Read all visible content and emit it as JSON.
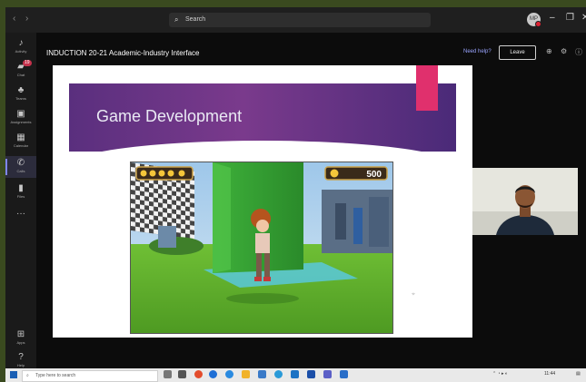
{
  "titlebar": {
    "back": "‹",
    "forward": "›",
    "search_placeholder": "Search",
    "user_initials": "MP",
    "minimize": "–",
    "maximize": "❐",
    "close": "✕"
  },
  "rail": [
    {
      "icon": "bell-icon",
      "glyph": "🔔",
      "label": "Activity",
      "active": false
    },
    {
      "icon": "chat-icon",
      "glyph": "💬",
      "label": "Chat",
      "badge": "19",
      "active": false
    },
    {
      "icon": "teams-icon",
      "glyph": "👥",
      "label": "Teams",
      "active": false
    },
    {
      "icon": "assignments-icon",
      "glyph": "🎒",
      "label": "Assignments",
      "active": false
    },
    {
      "icon": "calendar-icon",
      "glyph": "📅",
      "label": "Calendar",
      "active": false
    },
    {
      "icon": "calls-icon",
      "glyph": "📞",
      "label": "Calls",
      "active": true
    },
    {
      "icon": "files-icon",
      "glyph": "📄",
      "label": "Files",
      "active": false
    },
    {
      "icon": "more-icon",
      "glyph": "···",
      "label": "",
      "active": false
    }
  ],
  "rail_bottom": [
    {
      "icon": "apps-icon",
      "glyph": "⊞",
      "label": "Apps"
    },
    {
      "icon": "help-icon",
      "glyph": "?",
      "label": "Help"
    }
  ],
  "meeting": {
    "title": "INDUCTION 20-21 Academic-Industry Interface",
    "need_help": "Need help?",
    "leave": "Leave"
  },
  "slide": {
    "title": "Game Development"
  },
  "game_hud": {
    "coins": "500"
  },
  "taskbar": {
    "search_placeholder": "Type here to search",
    "time": "11:44"
  },
  "colors": {
    "accent_pink": "#e0306d",
    "banner_purple": "#5a2f7e",
    "teams_purple": "#7f85f5",
    "badge_red": "#c4314b"
  }
}
